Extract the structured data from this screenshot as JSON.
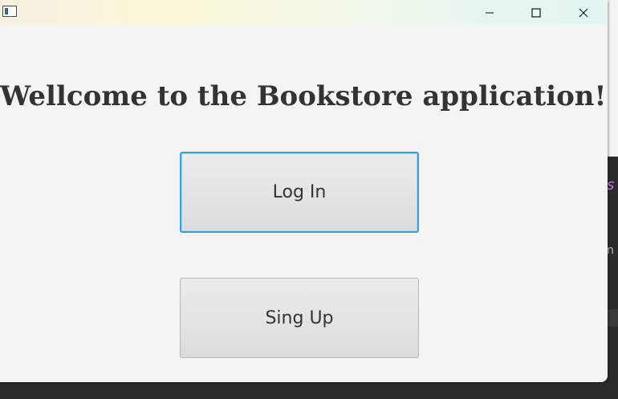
{
  "window": {
    "title": "",
    "controls": {
      "minimize_icon": "minimize-icon",
      "maximize_icon": "maximize-icon",
      "close_icon": "close-icon"
    }
  },
  "main": {
    "heading": "Wellcome to the Bookstore application!",
    "login_label": "Log In",
    "signup_label": "Sing Up"
  },
  "background": {
    "fragment_1": "s",
    "fragment_2": "n"
  },
  "colors": {
    "focus_border": "#2fa3e0",
    "window_bg": "#f4f4f4",
    "heading_text": "#333333"
  }
}
